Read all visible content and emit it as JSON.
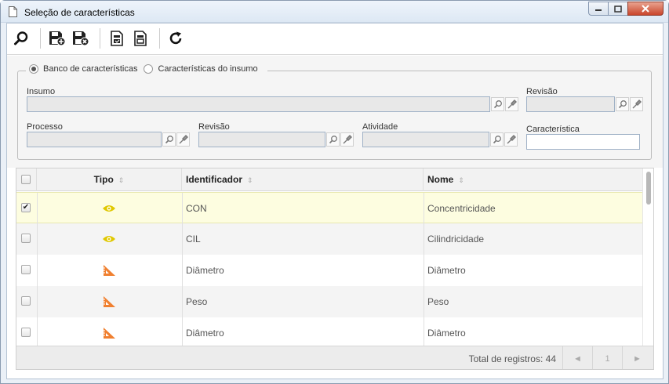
{
  "window": {
    "title": "Seleção de características"
  },
  "toolbar": {
    "buttons": [
      "search-icon",
      "save-icon",
      "save-close-icon",
      "doc-check-icon",
      "doc-view-icon",
      "refresh-icon"
    ]
  },
  "filter": {
    "radio": {
      "option1": "Banco de características",
      "option2": "Características do insumo",
      "selected": "option1"
    },
    "insumo_label": "Insumo",
    "revisao1_label": "Revisão",
    "processo_label": "Processo",
    "revisao2_label": "Revisão",
    "atividade_label": "Atividade",
    "caracteristica_label": "Característica"
  },
  "grid": {
    "columns": {
      "tipo": "Tipo",
      "identificador": "Identificador",
      "nome": "Nome"
    },
    "rows": [
      {
        "checked": true,
        "tipo": "eye-icon",
        "identificador": "CON",
        "nome": "Concentricidade"
      },
      {
        "checked": false,
        "tipo": "eye-icon",
        "identificador": "CIL",
        "nome": "Cilindricidade"
      },
      {
        "checked": false,
        "tipo": "ruler-triangle-icon",
        "identificador": "Diâmetro",
        "nome": "Diâmetro"
      },
      {
        "checked": false,
        "tipo": "ruler-triangle-icon",
        "identificador": "Peso",
        "nome": "Peso"
      },
      {
        "checked": false,
        "tipo": "ruler-triangle-icon",
        "identificador": "Diâmetro",
        "nome": "Diâmetro"
      }
    ],
    "total_label": "Total de registros: 44",
    "pager": {
      "prev": "◄",
      "page": "1",
      "next": "►"
    }
  },
  "colors": {
    "selected_row": "#fdfde0",
    "alt_row": "#f4f4f4",
    "eye": "#e0c800",
    "ruler": "#f08030"
  }
}
